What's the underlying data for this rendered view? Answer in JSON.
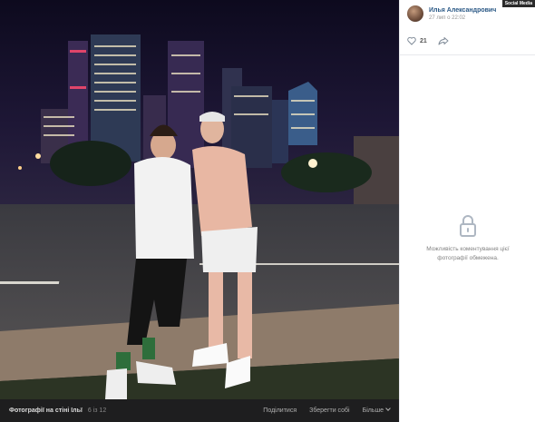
{
  "author": {
    "name": "Илья Александрович",
    "date": "27 лип о 22:02"
  },
  "badge": "Social Media",
  "likes": {
    "count": "21",
    "icon": "heart-outline"
  },
  "share_icon": "share-arrow",
  "comments": {
    "icon": "lock",
    "text": "Можливість коментування цієї фотографії обмежена."
  },
  "footer": {
    "title": "Фотографії на стіні Ільї",
    "counter": "6 із 12",
    "share_label": "Поділитися",
    "save_label": "Зберегти собі",
    "more_label": "Більше"
  },
  "colors": {
    "link": "#2a5885",
    "footer_bg": "#1e1e1f",
    "muted": "#939393"
  }
}
